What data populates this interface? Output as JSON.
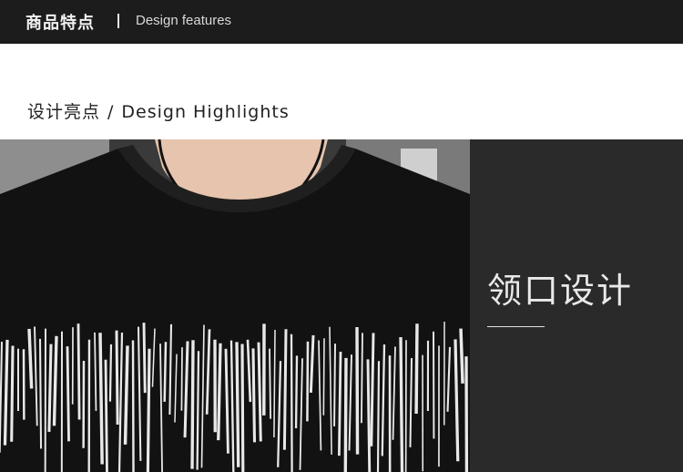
{
  "header": {
    "title_cn": "商品特点",
    "title_en": "Design features"
  },
  "section": {
    "title_cn": "设计亮点",
    "separator": "/",
    "title_en": "Design Highlights"
  },
  "feature": {
    "label": "领口设计"
  },
  "photo": {
    "subject": "black knit sweater with white vertical stripe pattern"
  }
}
